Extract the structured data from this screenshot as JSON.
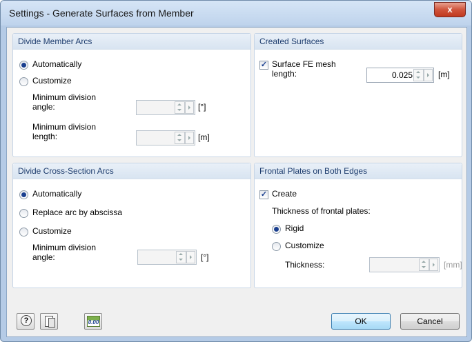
{
  "window": {
    "title": "Settings - Generate Surfaces from Member",
    "close_label": "x"
  },
  "divide_member_arcs": {
    "header": "Divide Member Arcs",
    "auto_label": "Automatically",
    "customize_label": "Customize",
    "angle_label_1": "Minimum division",
    "angle_label_2": "angle:",
    "angle_unit": "[°]",
    "length_label_1": "Minimum division",
    "length_label_2": "length:",
    "length_unit": "[m]"
  },
  "created_surfaces": {
    "header": "Created Surfaces",
    "mesh_label_1": "Surface FE mesh",
    "mesh_label_2": "length:",
    "mesh_value": "0.025",
    "mesh_unit": "[m]"
  },
  "divide_cross_section_arcs": {
    "header": "Divide Cross-Section Arcs",
    "auto_label": "Automatically",
    "replace_label": "Replace arc by abscissa",
    "customize_label": "Customize",
    "angle_label_1": "Minimum division",
    "angle_label_2": "angle:",
    "angle_unit": "[°]"
  },
  "frontal_plates": {
    "header": "Frontal Plates on Both Edges",
    "create_label": "Create",
    "thickness_heading": "Thickness of frontal plates:",
    "rigid_label": "Rigid",
    "customize_label": "Customize",
    "thickness_label": "Thickness:",
    "thickness_unit": "[mm]"
  },
  "footer": {
    "ok_label": "OK",
    "cancel_label": "Cancel",
    "help_icon_text": "?",
    "decimal_icon_text": "0.00"
  }
}
